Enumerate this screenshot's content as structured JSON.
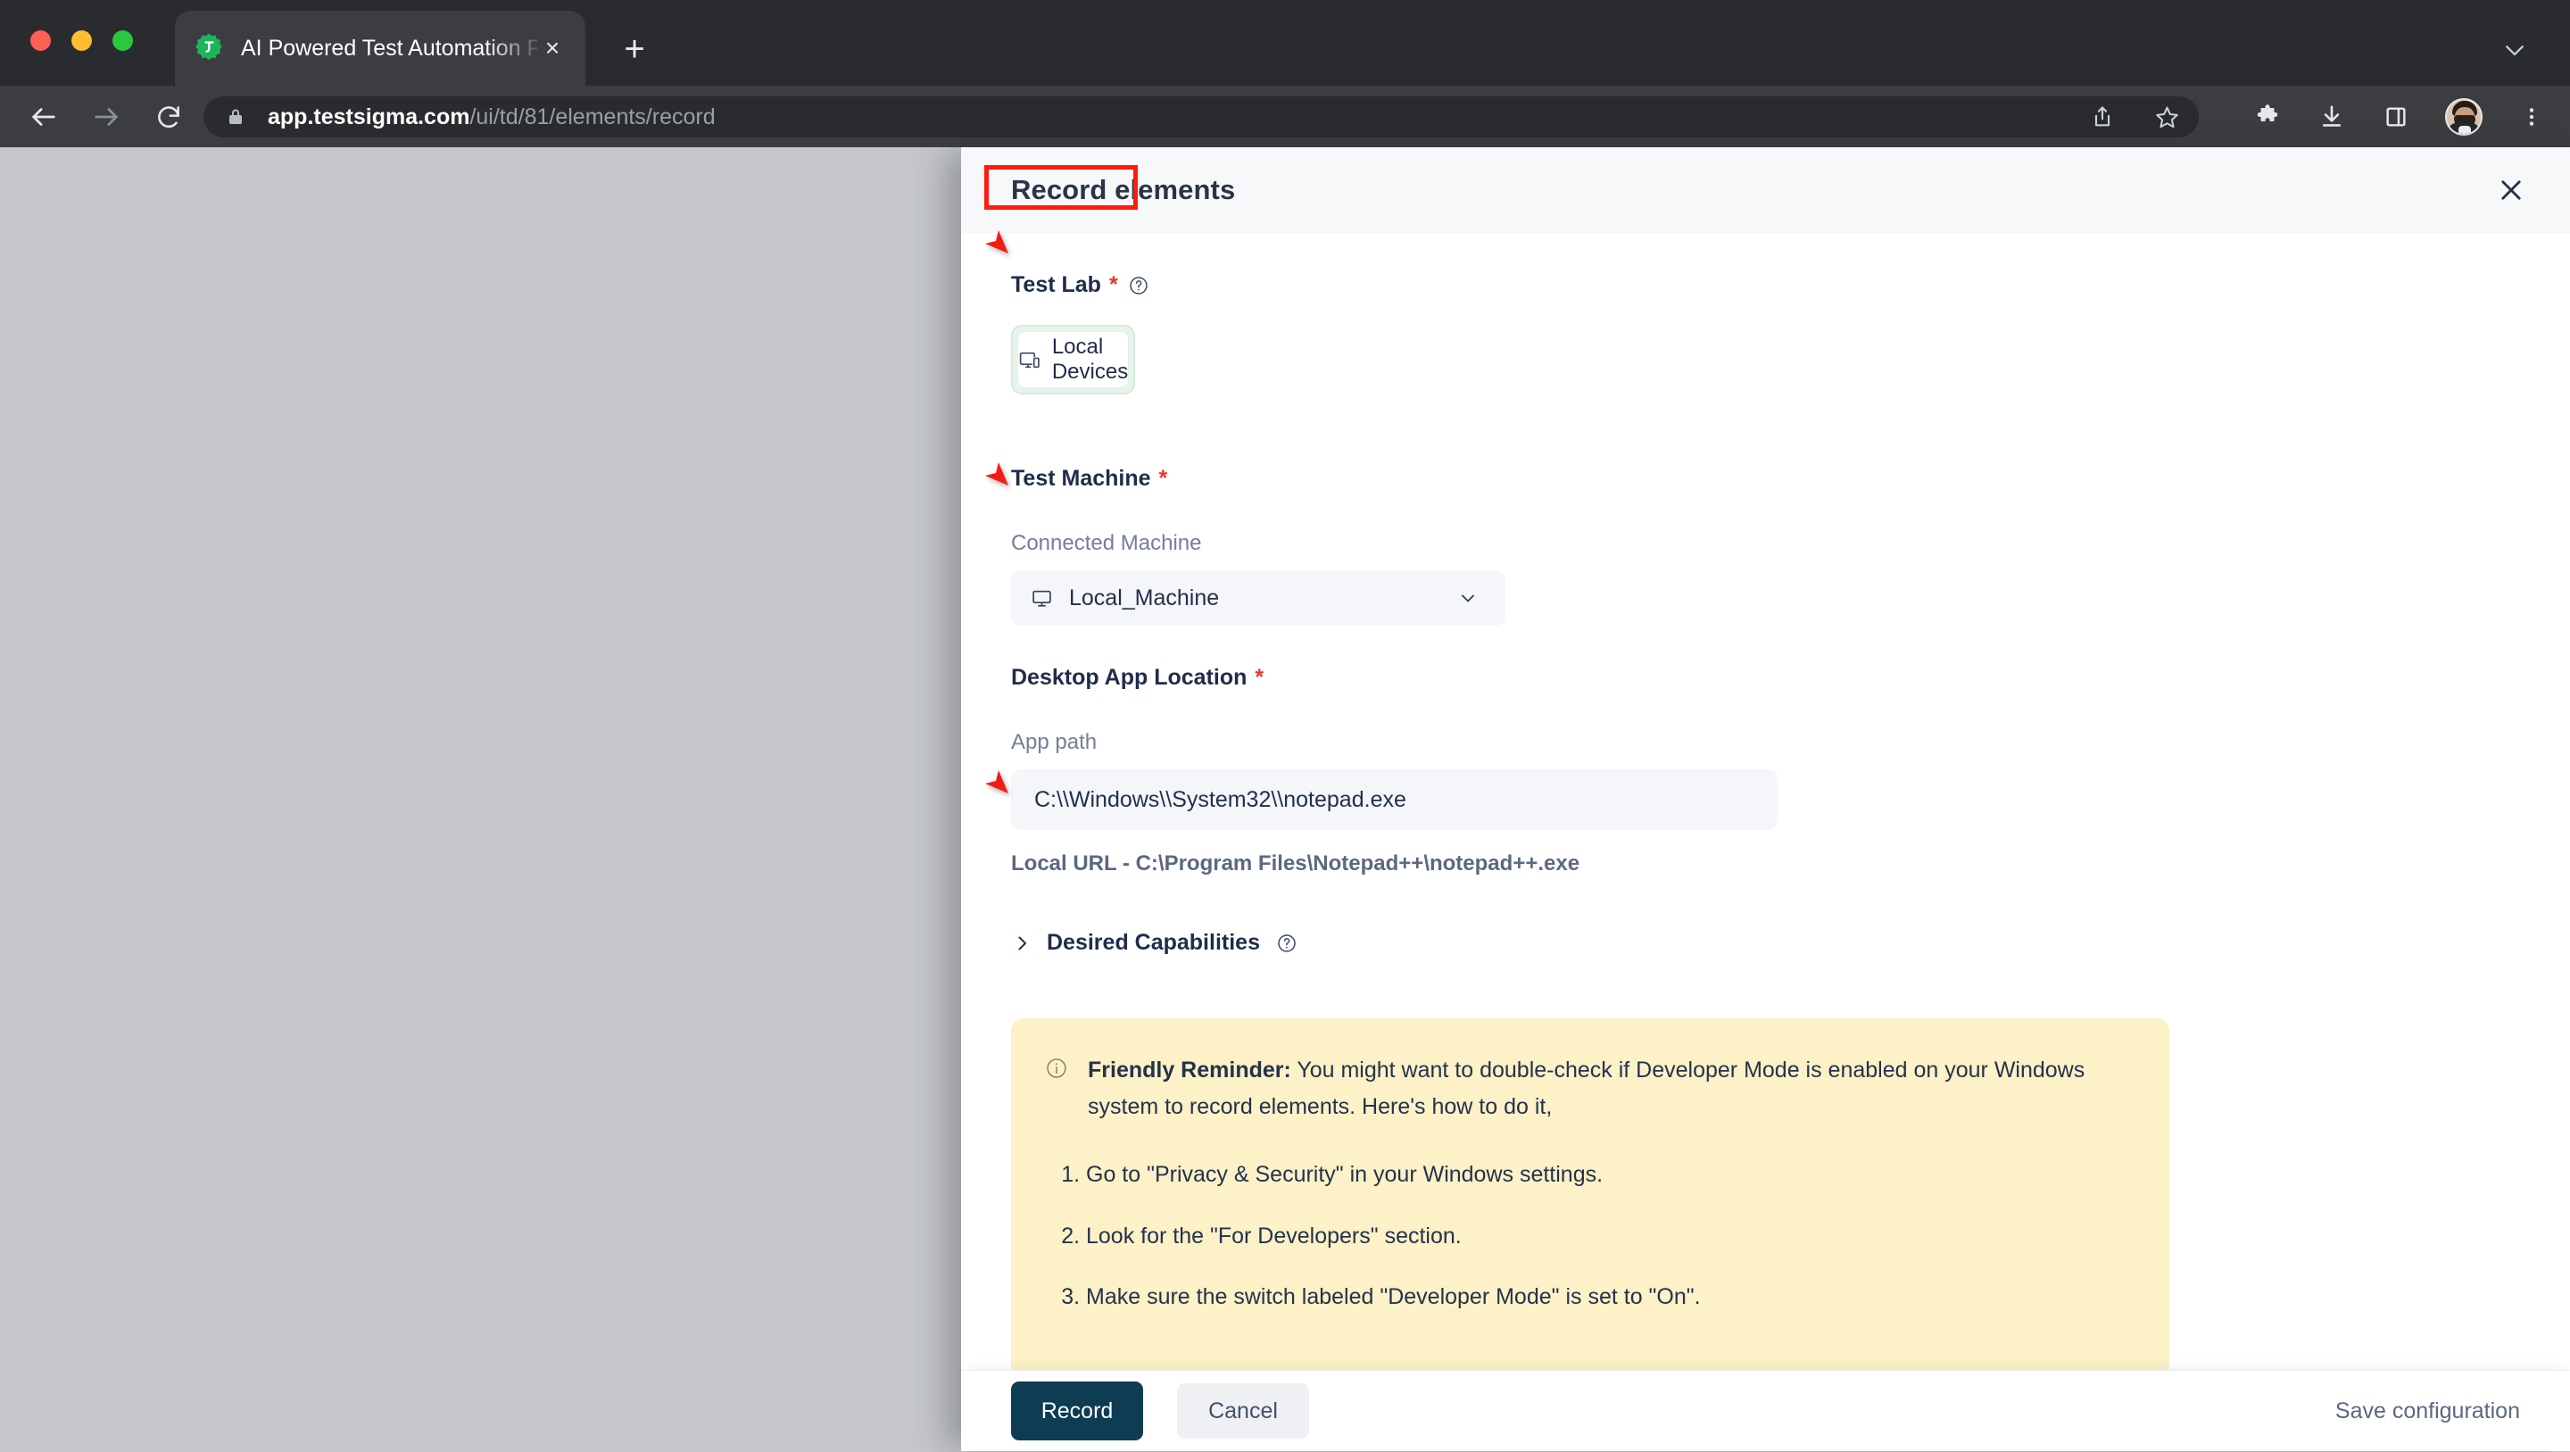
{
  "browser": {
    "tab": {
      "title": "AI Powered Test Automation Pl",
      "favicon_name": "testsigma-logo-icon",
      "close_label": "×"
    },
    "new_tab_label": "+",
    "toolbar": {
      "back_icon": "back-arrow-icon",
      "forward_icon": "forward-arrow-icon",
      "reload_icon": "reload-icon",
      "lock_icon": "lock-icon",
      "url_domain": "app.testsigma.com",
      "url_path": "/ui/td/81/elements/record",
      "share_icon": "share-icon",
      "bookmark_icon": "star-icon",
      "extensions_icon": "puzzle-icon",
      "downloads_icon": "download-icon",
      "side_panel_icon": "side-panel-icon",
      "profile_icon": "avatar",
      "menu_icon": "three-dots-icon"
    },
    "tabstrip_collapse_icon": "chevron-down-icon"
  },
  "modal": {
    "title": "Record elements",
    "close_icon": "close-icon",
    "test_lab": {
      "label": "Test Lab",
      "required_mark": "*",
      "help_icon": "question-circle-icon",
      "option_label": "Local Devices",
      "option_icon": "devices-icon"
    },
    "test_machine": {
      "label": "Test Machine",
      "required_mark": "*",
      "sub_label": "Connected Machine",
      "selected_value": "Local_Machine",
      "select_icon": "monitor-icon",
      "chevron_icon": "chevron-down-icon"
    },
    "desktop_app": {
      "label": "Desktop App Location",
      "required_mark": "*",
      "field_label": "App path",
      "field_value": "C:\\\\Windows\\\\System32\\\\notepad.exe",
      "field_placeholder": "App path",
      "hint": "Local URL - C:\\Program Files\\Notepad++\\notepad++.exe"
    },
    "desired_capabilities": {
      "label": "Desired Capabilities",
      "chevron_icon": "chevron-right-icon",
      "help_icon": "question-circle-icon"
    },
    "reminder": {
      "info_icon": "info-circle-icon",
      "bold_lead": "Friendly Reminder:",
      "body": " You might want to double-check if Developer Mode is enabled on your Windows system to record elements. Here's how to do it,",
      "steps": [
        "Go to \"Privacy & Security\" in your Windows settings.",
        "Look for the \"For Developers\" section.",
        "Make sure the switch labeled \"Developer Mode\" is set to \"On\"."
      ]
    },
    "footer": {
      "record_label": "Record",
      "cancel_label": "Cancel",
      "save_config_label": "Save configuration"
    }
  },
  "annotations": {
    "title_box_color": "#ff1a10",
    "arrow_color": "#f21d12",
    "arrows": [
      {
        "name": "arrow-to-test-lab"
      },
      {
        "name": "arrow-to-test-machine"
      },
      {
        "name": "arrow-to-app-path"
      }
    ]
  },
  "colors": {
    "accent_dark": "#0e3c52",
    "required_red": "#e8352b",
    "reminder_bg": "#fdf1c7",
    "backdrop": "#c5c7cb",
    "selected_card_ring": "#e7f4ea"
  }
}
